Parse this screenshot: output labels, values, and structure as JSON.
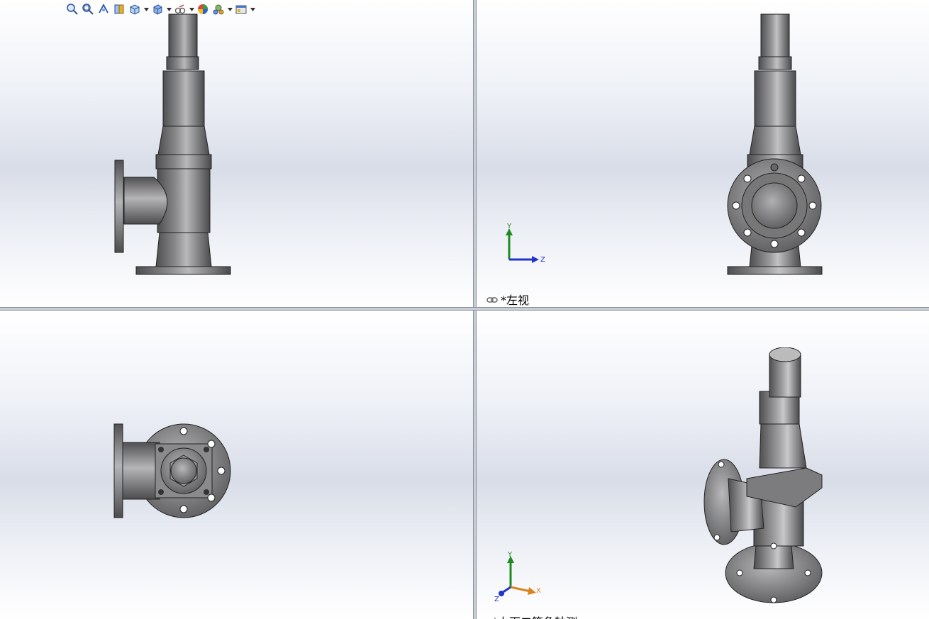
{
  "toolbar": {
    "items": [
      {
        "icon": "zoom-to-fit-icon"
      },
      {
        "icon": "zoom-to-area-icon"
      },
      {
        "icon": "previous-view-icon"
      },
      {
        "icon": "section-view-icon"
      },
      {
        "icon": "view-orientation-icon"
      },
      {
        "icon": "display-style-icon"
      },
      {
        "icon": "hide-show-items-icon"
      },
      {
        "icon": "edit-appearance-icon"
      },
      {
        "icon": "apply-scene-icon"
      },
      {
        "icon": "view-settings-icon"
      }
    ]
  },
  "viewports": {
    "top_right": {
      "label": "*左视",
      "triad": {
        "y": "Y",
        "z": "Z"
      }
    },
    "bottom_right": {
      "label_partial": "*上下二等角轴测",
      "triad": {
        "y": "Y",
        "z": "Z",
        "x": "X"
      }
    }
  },
  "colors": {
    "metal_dark": "#5a5a5c",
    "metal_light": "#bdbdbf",
    "axis_y": "#1f8a1f",
    "axis_z": "#2233cc",
    "axis_x": "#d9821e"
  }
}
